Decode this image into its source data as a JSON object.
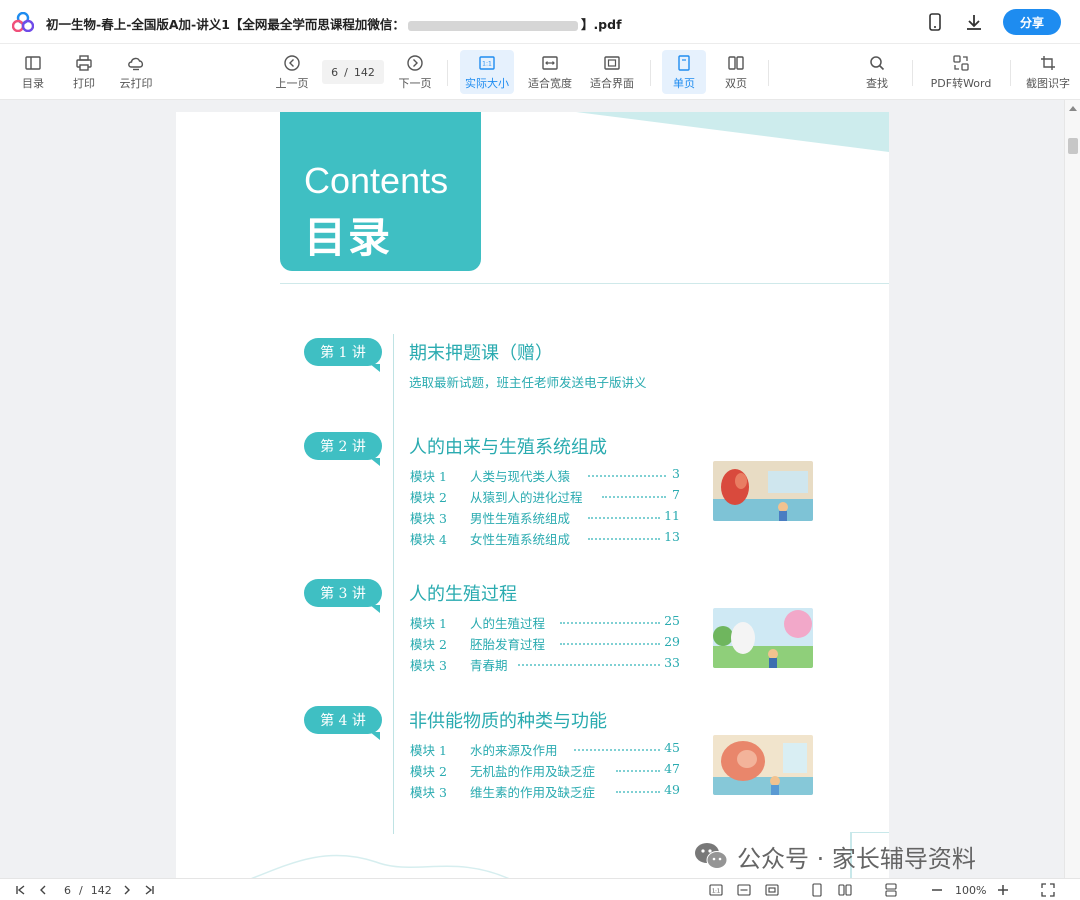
{
  "titlebar": {
    "title_part1": "初一生物-春上-全国版A加-讲义1【全网最全学而思课程加微信：",
    "title_part2": "】.pdf",
    "share_label": "分享"
  },
  "toolbar": {
    "toc": "目录",
    "print": "打印",
    "cloud_print": "云打印",
    "prev": "上一页",
    "page_current": "6",
    "page_sep": "/",
    "page_total": "142",
    "next": "下一页",
    "actual_size": "实际大小",
    "fit_width": "适合宽度",
    "fit_screen": "适合界面",
    "single": "单页",
    "double": "双页",
    "find": "查找",
    "pdf_to_word": "PDF转Word",
    "ocr": "截图识字"
  },
  "page": {
    "contents_en": "Contents",
    "contents_cn": "目录",
    "lectures": [
      {
        "tag": "第 1 讲",
        "title": "期末押题课（赠）",
        "subtitle": "选取最新试题，班主任老师发送电子版讲义",
        "modules": []
      },
      {
        "tag": "第 2 讲",
        "title": "人的由来与生殖系统组成",
        "modules": [
          {
            "label": "模块 1",
            "name": "人类与现代类人猿",
            "page": "3"
          },
          {
            "label": "模块 2",
            "name": "从猿到人的进化过程",
            "page": "7"
          },
          {
            "label": "模块 3",
            "name": "男性生殖系统组成",
            "page": "11"
          },
          {
            "label": "模块 4",
            "name": "女性生殖系统组成",
            "page": "13"
          }
        ]
      },
      {
        "tag": "第 3 讲",
        "title": "人的生殖过程",
        "modules": [
          {
            "label": "模块 1",
            "name": "人的生殖过程",
            "page": "25"
          },
          {
            "label": "模块 2",
            "name": "胚胎发育过程",
            "page": "29"
          },
          {
            "label": "模块 3",
            "name": "青春期",
            "page": "33"
          }
        ]
      },
      {
        "tag": "第 4 讲",
        "title": "非供能物质的种类与功能",
        "modules": [
          {
            "label": "模块 1",
            "name": "水的来源及作用",
            "page": "45"
          },
          {
            "label": "模块 2",
            "name": "无机盐的作用及缺乏症",
            "page": "47"
          },
          {
            "label": "模块 3",
            "name": "维生素的作用及缺乏症",
            "page": "49"
          }
        ]
      }
    ]
  },
  "watermark": {
    "text": "公众号 · 家长辅导资料"
  },
  "bottombar": {
    "page_current": "6",
    "page_sep": "/",
    "page_total": "142",
    "zoom": "100%"
  },
  "colors": {
    "accent": "#1e8cf0",
    "teal": "#3fbfc3",
    "teal_text": "#2aabb0"
  }
}
